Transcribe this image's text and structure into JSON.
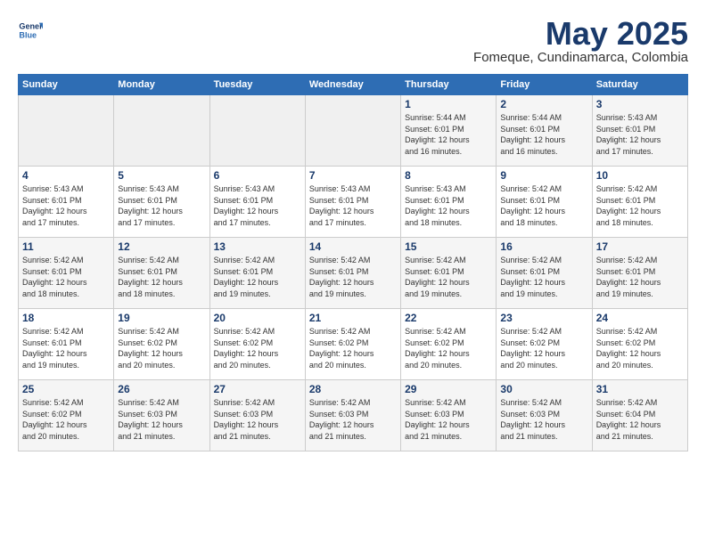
{
  "header": {
    "logo_line1": "General",
    "logo_line2": "Blue",
    "month": "May 2025",
    "location": "Fomeque, Cundinamarca, Colombia"
  },
  "weekdays": [
    "Sunday",
    "Monday",
    "Tuesday",
    "Wednesday",
    "Thursday",
    "Friday",
    "Saturday"
  ],
  "weeks": [
    [
      {
        "day": "",
        "info": ""
      },
      {
        "day": "",
        "info": ""
      },
      {
        "day": "",
        "info": ""
      },
      {
        "day": "",
        "info": ""
      },
      {
        "day": "1",
        "info": "Sunrise: 5:44 AM\nSunset: 6:01 PM\nDaylight: 12 hours\nand 16 minutes."
      },
      {
        "day": "2",
        "info": "Sunrise: 5:44 AM\nSunset: 6:01 PM\nDaylight: 12 hours\nand 16 minutes."
      },
      {
        "day": "3",
        "info": "Sunrise: 5:43 AM\nSunset: 6:01 PM\nDaylight: 12 hours\nand 17 minutes."
      }
    ],
    [
      {
        "day": "4",
        "info": "Sunrise: 5:43 AM\nSunset: 6:01 PM\nDaylight: 12 hours\nand 17 minutes."
      },
      {
        "day": "5",
        "info": "Sunrise: 5:43 AM\nSunset: 6:01 PM\nDaylight: 12 hours\nand 17 minutes."
      },
      {
        "day": "6",
        "info": "Sunrise: 5:43 AM\nSunset: 6:01 PM\nDaylight: 12 hours\nand 17 minutes."
      },
      {
        "day": "7",
        "info": "Sunrise: 5:43 AM\nSunset: 6:01 PM\nDaylight: 12 hours\nand 17 minutes."
      },
      {
        "day": "8",
        "info": "Sunrise: 5:43 AM\nSunset: 6:01 PM\nDaylight: 12 hours\nand 18 minutes."
      },
      {
        "day": "9",
        "info": "Sunrise: 5:42 AM\nSunset: 6:01 PM\nDaylight: 12 hours\nand 18 minutes."
      },
      {
        "day": "10",
        "info": "Sunrise: 5:42 AM\nSunset: 6:01 PM\nDaylight: 12 hours\nand 18 minutes."
      }
    ],
    [
      {
        "day": "11",
        "info": "Sunrise: 5:42 AM\nSunset: 6:01 PM\nDaylight: 12 hours\nand 18 minutes."
      },
      {
        "day": "12",
        "info": "Sunrise: 5:42 AM\nSunset: 6:01 PM\nDaylight: 12 hours\nand 18 minutes."
      },
      {
        "day": "13",
        "info": "Sunrise: 5:42 AM\nSunset: 6:01 PM\nDaylight: 12 hours\nand 19 minutes."
      },
      {
        "day": "14",
        "info": "Sunrise: 5:42 AM\nSunset: 6:01 PM\nDaylight: 12 hours\nand 19 minutes."
      },
      {
        "day": "15",
        "info": "Sunrise: 5:42 AM\nSunset: 6:01 PM\nDaylight: 12 hours\nand 19 minutes."
      },
      {
        "day": "16",
        "info": "Sunrise: 5:42 AM\nSunset: 6:01 PM\nDaylight: 12 hours\nand 19 minutes."
      },
      {
        "day": "17",
        "info": "Sunrise: 5:42 AM\nSunset: 6:01 PM\nDaylight: 12 hours\nand 19 minutes."
      }
    ],
    [
      {
        "day": "18",
        "info": "Sunrise: 5:42 AM\nSunset: 6:01 PM\nDaylight: 12 hours\nand 19 minutes."
      },
      {
        "day": "19",
        "info": "Sunrise: 5:42 AM\nSunset: 6:02 PM\nDaylight: 12 hours\nand 20 minutes."
      },
      {
        "day": "20",
        "info": "Sunrise: 5:42 AM\nSunset: 6:02 PM\nDaylight: 12 hours\nand 20 minutes."
      },
      {
        "day": "21",
        "info": "Sunrise: 5:42 AM\nSunset: 6:02 PM\nDaylight: 12 hours\nand 20 minutes."
      },
      {
        "day": "22",
        "info": "Sunrise: 5:42 AM\nSunset: 6:02 PM\nDaylight: 12 hours\nand 20 minutes."
      },
      {
        "day": "23",
        "info": "Sunrise: 5:42 AM\nSunset: 6:02 PM\nDaylight: 12 hours\nand 20 minutes."
      },
      {
        "day": "24",
        "info": "Sunrise: 5:42 AM\nSunset: 6:02 PM\nDaylight: 12 hours\nand 20 minutes."
      }
    ],
    [
      {
        "day": "25",
        "info": "Sunrise: 5:42 AM\nSunset: 6:02 PM\nDaylight: 12 hours\nand 20 minutes."
      },
      {
        "day": "26",
        "info": "Sunrise: 5:42 AM\nSunset: 6:03 PM\nDaylight: 12 hours\nand 21 minutes."
      },
      {
        "day": "27",
        "info": "Sunrise: 5:42 AM\nSunset: 6:03 PM\nDaylight: 12 hours\nand 21 minutes."
      },
      {
        "day": "28",
        "info": "Sunrise: 5:42 AM\nSunset: 6:03 PM\nDaylight: 12 hours\nand 21 minutes."
      },
      {
        "day": "29",
        "info": "Sunrise: 5:42 AM\nSunset: 6:03 PM\nDaylight: 12 hours\nand 21 minutes."
      },
      {
        "day": "30",
        "info": "Sunrise: 5:42 AM\nSunset: 6:03 PM\nDaylight: 12 hours\nand 21 minutes."
      },
      {
        "day": "31",
        "info": "Sunrise: 5:42 AM\nSunset: 6:04 PM\nDaylight: 12 hours\nand 21 minutes."
      }
    ]
  ]
}
